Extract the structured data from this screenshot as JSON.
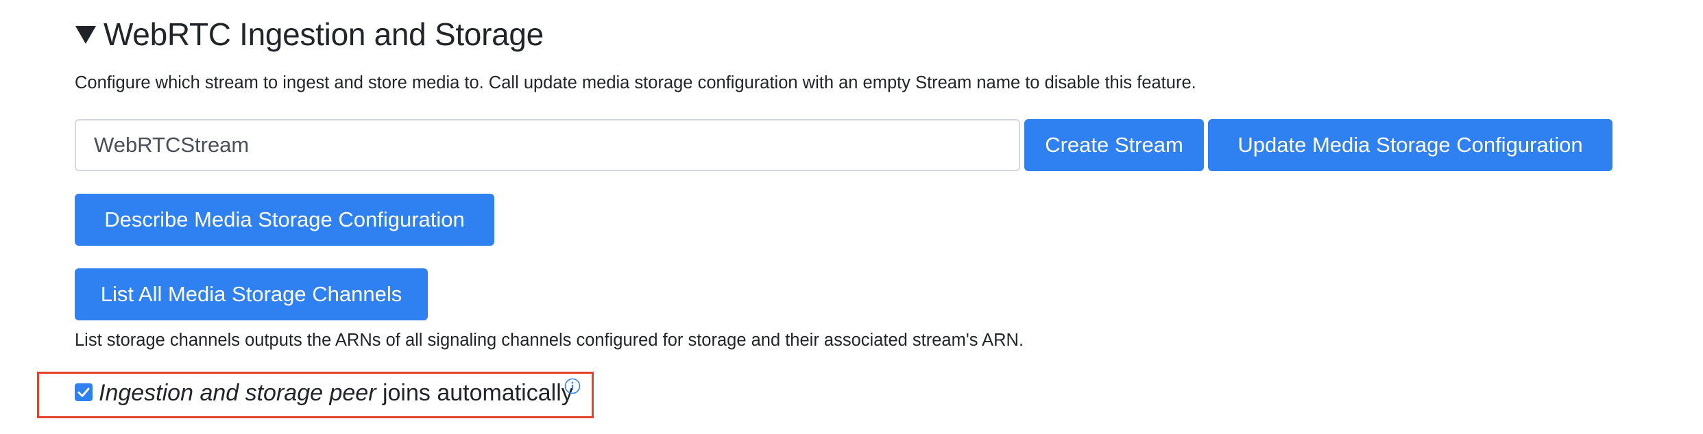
{
  "section": {
    "title": "WebRTC Ingestion and Storage",
    "toggle_icon": "triangle-down-icon",
    "description": "Configure which stream to ingest and store media to. Call update media storage configuration with an empty Stream name to disable this feature."
  },
  "stream_name_input": {
    "value": "WebRTCStream"
  },
  "buttons": {
    "create_stream": "Create Stream",
    "update_config": "Update Media Storage Configuration",
    "describe_config": "Describe Media Storage Configuration",
    "list_channels": "List All Media Storage Channels"
  },
  "list_channels_help": "List storage channels outputs the ARNs of all signaling channels configured for storage and their associated stream's ARN.",
  "auto_join": {
    "checked": true,
    "label_italic": "Ingestion and storage peer",
    "label_rest": " joins automatically",
    "info_icon": "info-circle-icon"
  },
  "colors": {
    "button": "#2f80f0",
    "highlight_border": "#e5412d",
    "text": "#212529"
  }
}
